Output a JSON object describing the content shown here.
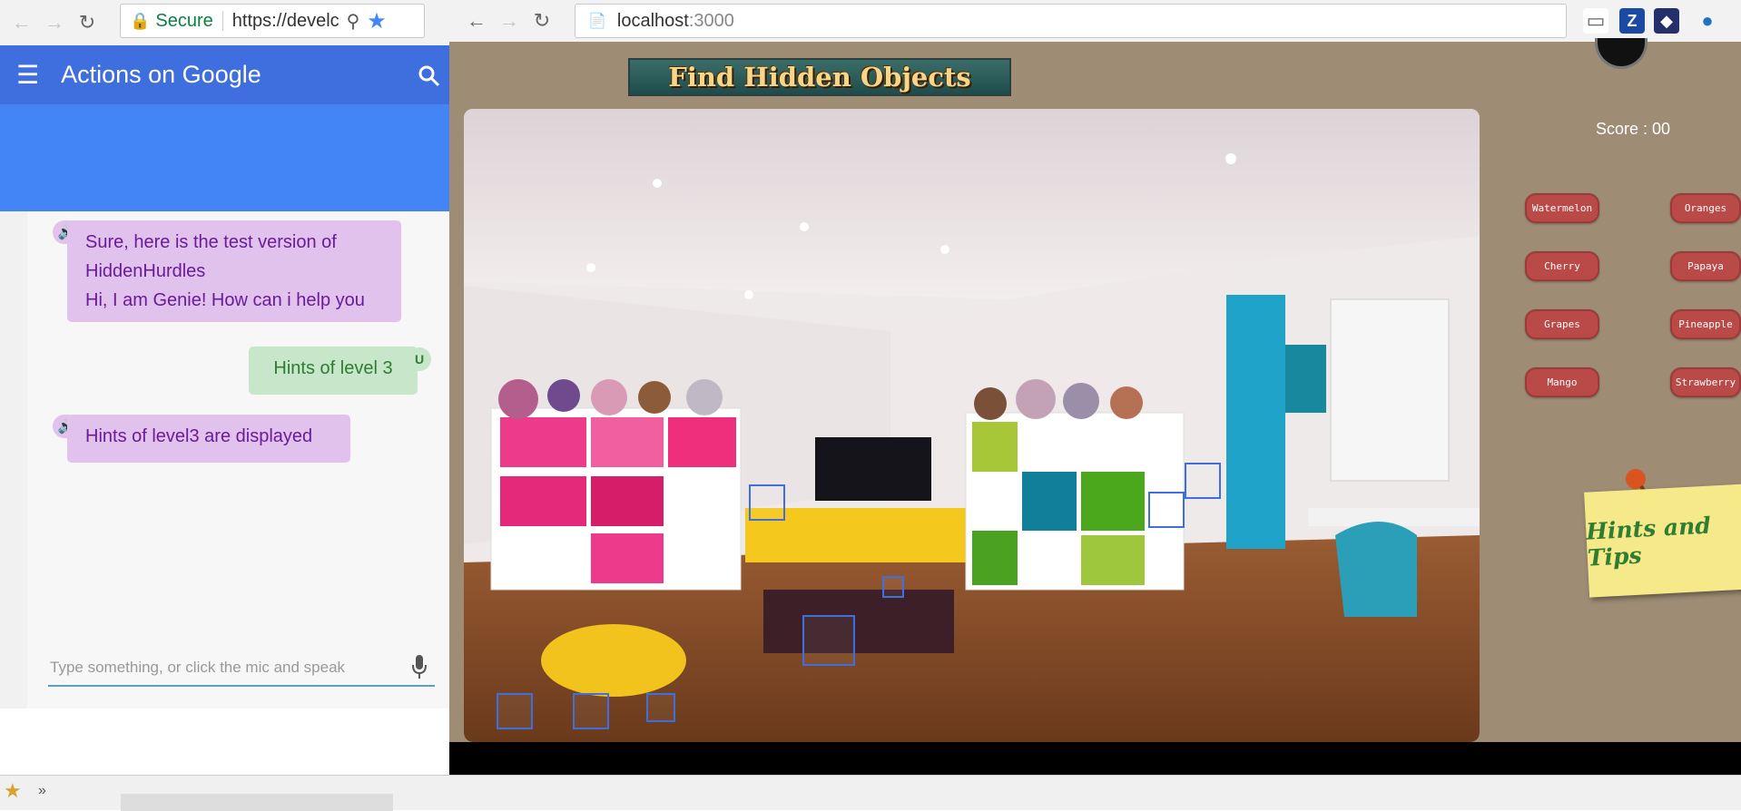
{
  "left_browser": {
    "secure_label": "Secure",
    "url": "https://develc",
    "app_title": "Actions on Google"
  },
  "chat": {
    "messages": [
      {
        "role": "genie",
        "lines": [
          "Sure, here is the test version of",
          "HiddenHurdles",
          "Hi, I am Genie! How can i help you"
        ]
      },
      {
        "role": "user",
        "text": "Hints of level 3",
        "badge": "U"
      },
      {
        "role": "genie",
        "text": "Hints of level3 are displayed"
      }
    ],
    "input_placeholder": "Type something, or click the mic and speak"
  },
  "right_browser": {
    "host": "localhost",
    "port": ":3000",
    "ext_z": "Z"
  },
  "game": {
    "title": "Find Hidden Objects",
    "score_label": "Score : 00",
    "fruits_left": [
      "Watermelon",
      "Cherry",
      "Grapes",
      "Mango"
    ],
    "fruits_right": [
      "Oranges",
      "Papaya",
      "Pineapple",
      "Strawberry"
    ],
    "hints_label": "Hints and Tips"
  },
  "colors": {
    "aog_bar": "#3f6fde",
    "aog_blue": "#4385f4",
    "game_bg": "#9e8c75",
    "fruit_button": "#b94a48",
    "secure_green": "#0b8043"
  }
}
